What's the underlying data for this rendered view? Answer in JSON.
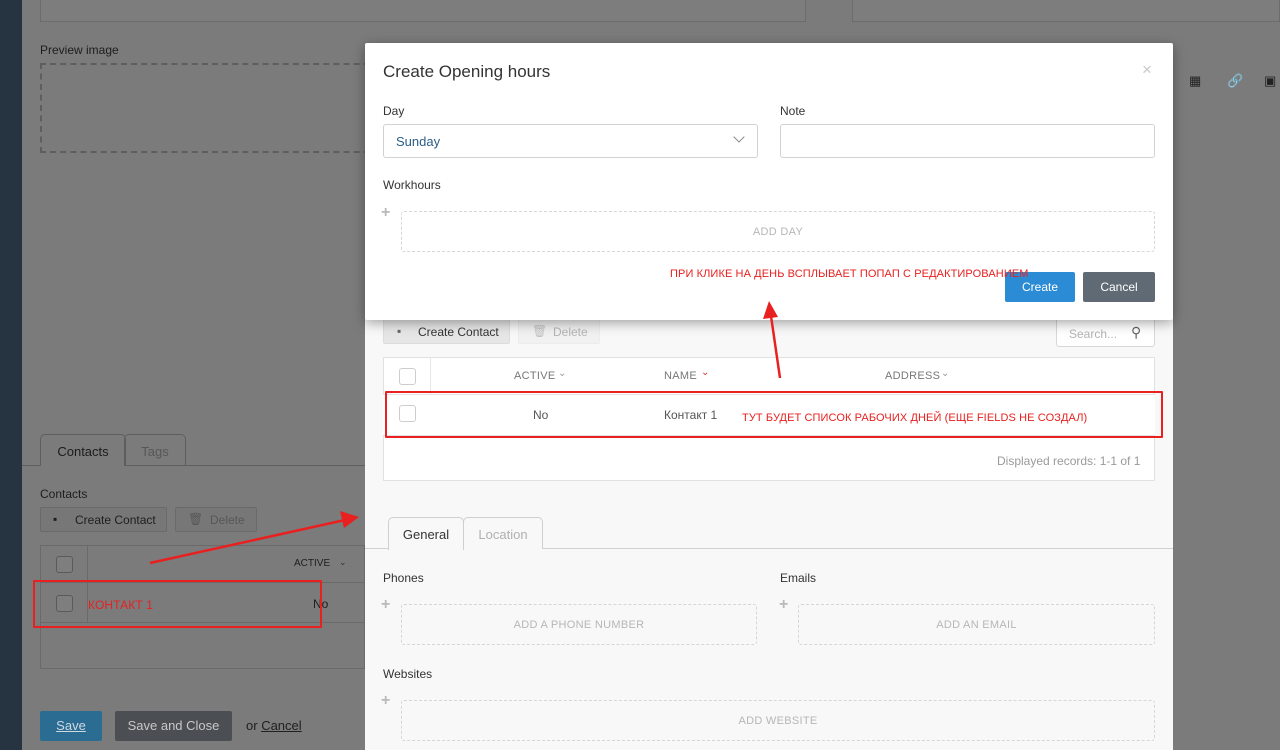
{
  "background": {
    "preview_label": "Preview image",
    "tabs": [
      {
        "label": "Contacts"
      },
      {
        "label": "Tags"
      }
    ],
    "contacts_label": "Contacts",
    "create_contact": "Create Contact",
    "delete": "Delete",
    "col_active": "ACTIVE",
    "row_active": "No",
    "save": "Save",
    "save_close": "Save and Close",
    "or": "or",
    "cancel": "Cancel"
  },
  "modal": {
    "title": "Create Opening hours",
    "close": "×",
    "day_label": "Day",
    "day_value": "Sunday",
    "note_label": "Note",
    "workhours_label": "Workhours",
    "add_day": "ADD DAY",
    "create": "Create",
    "cancel": "Cancel"
  },
  "window": {
    "create_contact": "Create Contact",
    "delete": "Delete",
    "search_placeholder": "Search...",
    "columns": {
      "active": "ACTIVE",
      "name": "NAME",
      "address": "ADDRESS"
    },
    "row": {
      "active": "No",
      "name": "Контакт 1"
    },
    "records": "Displayed records: 1-1 of 1",
    "tabs": [
      {
        "label": "General"
      },
      {
        "label": "Location"
      }
    ],
    "phones_label": "Phones",
    "add_phone": "ADD A PHONE NUMBER",
    "emails_label": "Emails",
    "add_email": "ADD AN EMAIL",
    "websites_label": "Websites",
    "add_website": "ADD WEBSITE"
  },
  "annotations": {
    "popup_note": "ПРИ КЛИКЕ НА ДЕНЬ ВСПЛЫВАЕТ ПОПАП С РЕДАКТИРОВАНИЕМ",
    "list_note": "ТУТ БУДЕТ СПИСОК РАБОЧИХ ДНЕЙ (ЕЩЕ FIELDS НЕ СОЗДАЛ)",
    "contact_note": "КОНТАКТ 1"
  },
  "colors": {
    "primary": "#2b8bd4",
    "secondary": "#606a75",
    "annotation": "#e8201f",
    "overlay": "#7b7b7b"
  }
}
